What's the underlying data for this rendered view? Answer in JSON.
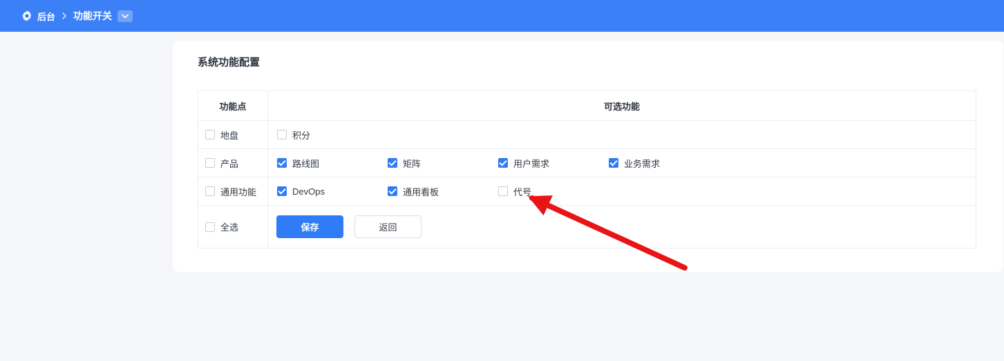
{
  "topbar": {
    "breadcrumb": [
      {
        "label": "后台"
      },
      {
        "label": "功能开关"
      }
    ]
  },
  "page": {
    "title": "系统功能配置"
  },
  "table": {
    "headers": {
      "feature_point": "功能点",
      "optional_features": "可选功能"
    },
    "rows": [
      {
        "group": {
          "label": "地盘",
          "checked": false
        },
        "options": [
          {
            "label": "积分",
            "checked": false
          }
        ]
      },
      {
        "group": {
          "label": "产品",
          "checked": false
        },
        "options": [
          {
            "label": "路线图",
            "checked": true
          },
          {
            "label": "矩阵",
            "checked": true
          },
          {
            "label": "用户需求",
            "checked": true
          },
          {
            "label": "业务需求",
            "checked": true
          }
        ]
      },
      {
        "group": {
          "label": "通用功能",
          "checked": false
        },
        "options": [
          {
            "label": "DevOps",
            "checked": true
          },
          {
            "label": "通用看板",
            "checked": true
          },
          {
            "label": "代号",
            "checked": false
          }
        ]
      }
    ],
    "footer": {
      "select_all": {
        "label": "全选",
        "checked": false
      },
      "save_label": "保存",
      "back_label": "返回"
    }
  },
  "colors": {
    "topbar_blue": "#3c80f8",
    "primary_blue": "#2f7cf6",
    "arrow_red": "#e81416",
    "page_background": "#f5f6f8"
  }
}
